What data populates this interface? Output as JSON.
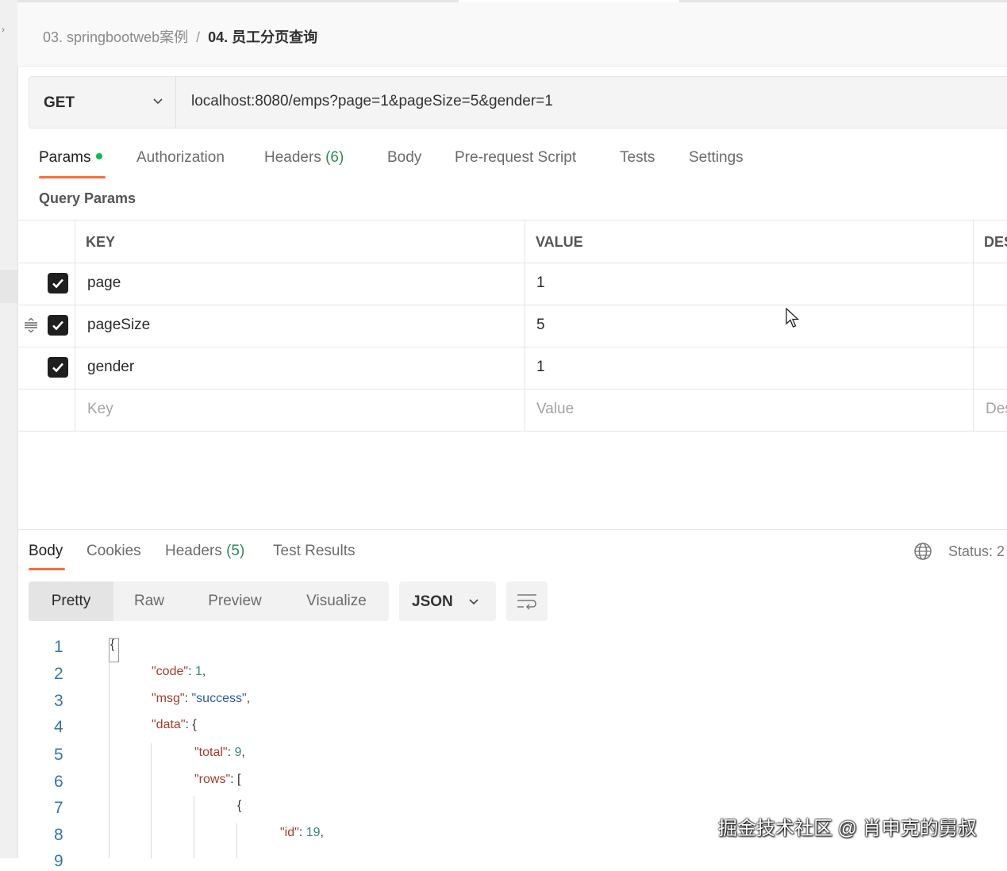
{
  "breadcrumb": {
    "parent": "03. springbootweb案例",
    "separator": "/",
    "current": "04. 员工分页查询"
  },
  "request": {
    "method": "GET",
    "url": "localhost:8080/emps?page=1&pageSize=5&gender=1"
  },
  "request_tabs": {
    "params": "Params",
    "authorization": "Authorization",
    "headers": "Headers",
    "headers_count": "(6)",
    "body": "Body",
    "prerequest": "Pre-request Script",
    "tests": "Tests",
    "settings": "Settings"
  },
  "query_params": {
    "title": "Query Params",
    "columns": {
      "key": "KEY",
      "value": "VALUE",
      "description": "DES"
    },
    "rows": [
      {
        "key": "page",
        "value": "1"
      },
      {
        "key": "pageSize",
        "value": "5"
      },
      {
        "key": "gender",
        "value": "1"
      }
    ],
    "placeholder": {
      "key": "Key",
      "value": "Value",
      "description": "Des"
    }
  },
  "response_tabs": {
    "body": "Body",
    "cookies": "Cookies",
    "headers": "Headers",
    "headers_count": "(5)",
    "test_results": "Test Results"
  },
  "status_text": "Status: 2",
  "view_modes": {
    "pretty": "Pretty",
    "raw": "Raw",
    "preview": "Preview",
    "visualize": "Visualize"
  },
  "format": "JSON",
  "code_lines": [
    {
      "num": "1"
    },
    {
      "num": "2"
    },
    {
      "num": "3"
    },
    {
      "num": "4"
    },
    {
      "num": "5"
    },
    {
      "num": "6"
    },
    {
      "num": "7"
    },
    {
      "num": "8"
    }
  ],
  "response_json": {
    "open_brace": "{",
    "code_key": "\"code\"",
    "code_value": "1",
    "msg_key": "\"msg\"",
    "msg_value": "\"success\"",
    "data_key": "\"data\"",
    "total_key": "\"total\"",
    "total_value": "9",
    "rows_key": "\"rows\"",
    "row_open": "{",
    "id_key": "\"id\"",
    "id_value": "19"
  },
  "watermark": "掘金技术社区 @ 肖申克的舅叔",
  "colors": {
    "accent": "#ff6c37",
    "success_dot": "#0cbb52",
    "count": "#2e8b57"
  }
}
